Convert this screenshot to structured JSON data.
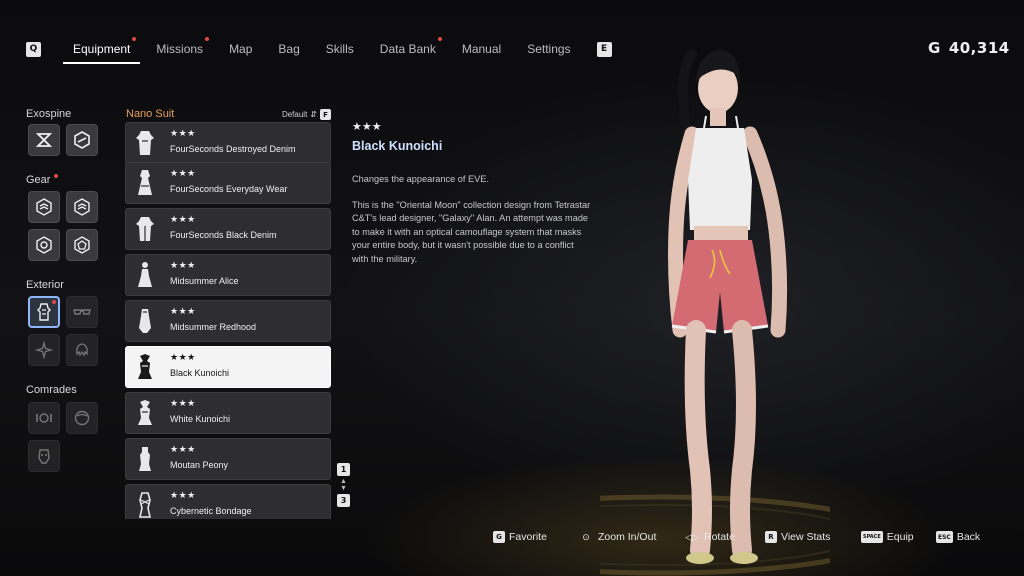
{
  "nav": {
    "left_key": "Q",
    "right_key": "E",
    "tabs": [
      {
        "label": "Equipment",
        "active": true,
        "alert": true
      },
      {
        "label": "Missions",
        "active": false,
        "alert": true
      },
      {
        "label": "Map",
        "active": false,
        "alert": false
      },
      {
        "label": "Bag",
        "active": false,
        "alert": false
      },
      {
        "label": "Skills",
        "active": false,
        "alert": false
      },
      {
        "label": "Data Bank",
        "active": false,
        "alert": true
      },
      {
        "label": "Manual",
        "active": false,
        "alert": false
      },
      {
        "label": "Settings",
        "active": false,
        "alert": false
      }
    ]
  },
  "currency": {
    "symbol": "G",
    "amount": "40,314"
  },
  "categories": {
    "exospine": "Exospine",
    "gear": "Gear",
    "exterior": "Exterior",
    "comrades": "Comrades"
  },
  "list": {
    "title": "Nano Suit",
    "sort_label": "Default",
    "sort_key": "F",
    "items": [
      {
        "stars": "★★★",
        "name": "FourSeconds Destroyed Denim",
        "selected": false
      },
      {
        "stars": "★★★",
        "name": "FourSeconds Everyday Wear",
        "selected": false
      },
      {
        "stars": "★★★",
        "name": "FourSeconds Black Denim",
        "selected": false
      },
      {
        "stars": "★★★",
        "name": "Midsummer Alice",
        "selected": false
      },
      {
        "stars": "★★★",
        "name": "Midsummer Redhood",
        "selected": false
      },
      {
        "stars": "★★★",
        "name": "Black Kunoichi",
        "selected": true
      },
      {
        "stars": "★★★",
        "name": "White Kunoichi",
        "selected": false
      },
      {
        "stars": "★★★",
        "name": "Moutan Peony",
        "selected": false
      },
      {
        "stars": "★★★",
        "name": "Cybernetic Bondage",
        "selected": false
      }
    ],
    "page_current": "1",
    "page_total": "3"
  },
  "detail": {
    "stars": "★★★",
    "title": "Black Kunoichi",
    "desc_1": "Changes the appearance of EVE.",
    "desc_2": "This is the \"Oriental Moon\" collection design from Tetrastar C&T's lead designer, \"Galaxy\" Alan. An attempt was made to make it with an optical camouflage system that masks your entire body, but it wasn't possible due to a conflict with the military."
  },
  "hints": {
    "favorite": {
      "key": "G",
      "label": "Favorite"
    },
    "zoom": {
      "label": "Zoom In/Out"
    },
    "rotate": {
      "label": "Rotate"
    },
    "view_stats": {
      "key": "R",
      "label": "View Stats"
    },
    "equip": {
      "key": "SPACE",
      "label": "Equip"
    },
    "back": {
      "key": "ESC",
      "label": "Back"
    }
  }
}
